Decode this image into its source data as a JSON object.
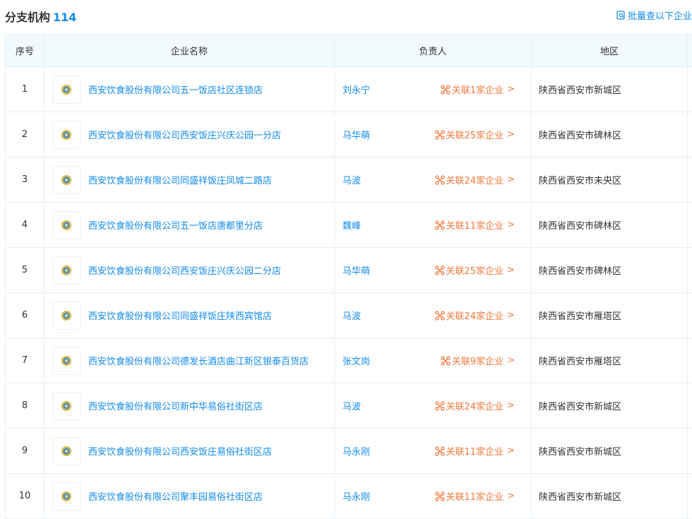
{
  "header": {
    "title": "分支机构",
    "count": "114",
    "batch_link": "批量查以下企业"
  },
  "table": {
    "columns": {
      "index": "序号",
      "name": "企业名称",
      "person": "负责人",
      "region": "地区"
    },
    "rows": [
      {
        "index": "1",
        "name": "西安饮食股份有限公司五一饭店社区连锁店",
        "person": "刘永宁",
        "related": "关联1家企业",
        "region": "陕西省西安市新城区"
      },
      {
        "index": "2",
        "name": "西安饮食股份有限公司西安饭庄兴庆公园一分店",
        "person": "马华萌",
        "related": "关联25家企业",
        "region": "陕西省西安市碑林区"
      },
      {
        "index": "3",
        "name": "西安饮食股份有限公司同盛祥饭庄凤城二路店",
        "person": "马波",
        "related": "关联24家企业",
        "region": "陕西省西安市未央区"
      },
      {
        "index": "4",
        "name": "西安饮食股份有限公司五一饭店唐都里分店",
        "person": "魏峰",
        "related": "关联11家企业",
        "region": "陕西省西安市碑林区"
      },
      {
        "index": "5",
        "name": "西安饮食股份有限公司西安饭庄兴庆公园二分店",
        "person": "马华萌",
        "related": "关联25家企业",
        "region": "陕西省西安市碑林区"
      },
      {
        "index": "6",
        "name": "西安饮食股份有限公司同盛祥饭庄陕西宾馆店",
        "person": "马波",
        "related": "关联24家企业",
        "region": "陕西省西安市雁塔区"
      },
      {
        "index": "7",
        "name": "西安饮食股份有限公司德发长酒店曲江新区银泰百货店",
        "person": "张文岗",
        "related": "关联9家企业",
        "region": "陕西省西安市雁塔区"
      },
      {
        "index": "8",
        "name": "西安饮食股份有限公司新中华易俗社街区店",
        "person": "马波",
        "related": "关联24家企业",
        "region": "陕西省西安市新城区"
      },
      {
        "index": "9",
        "name": "西安饮食股份有限公司西安饭庄易俗社街区店",
        "person": "马永刚",
        "related": "关联11家企业",
        "region": "陕西省西安市新城区"
      },
      {
        "index": "10",
        "name": "西安饮食股份有限公司聚丰园易俗社街区店",
        "person": "马永刚",
        "related": "关联11家企业",
        "region": "陕西省西安市新城区"
      }
    ]
  },
  "icons": {
    "batch": "search-document-icon",
    "logo": "company-logo-emblem",
    "related": "relation-network-icon",
    "arrow": "chevron-right-icon"
  },
  "colors": {
    "link": "#128bed",
    "related": "#f0783c",
    "header_bg": "#f2f9fc",
    "border": "#e4eef6"
  }
}
